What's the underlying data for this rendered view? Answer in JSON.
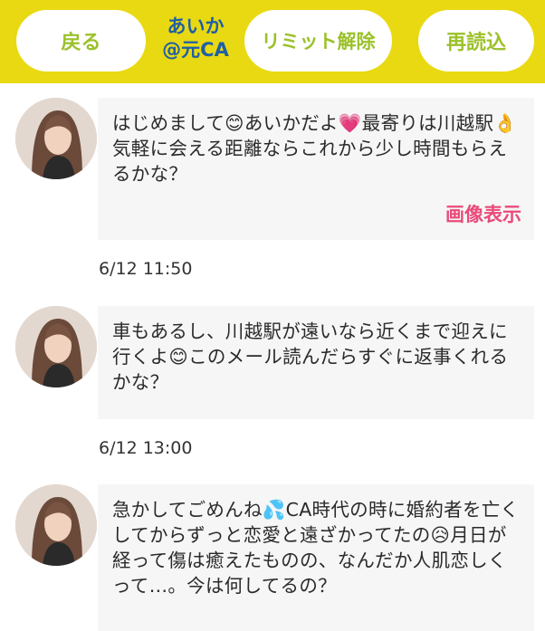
{
  "header": {
    "back_label": "戻る",
    "title_line1": "あいか",
    "title_line2": "@元CA",
    "limit_label": "リミット解除",
    "reload_label": "再読込",
    "bg_color": "#e9d912",
    "button_text_color": "#9bc12a",
    "title_color": "#1f5fa5"
  },
  "messages": [
    {
      "avatar_icon": "woman-portrait-icon",
      "text": "はじめまして😊あいかだよ💗最寄りは川越駅👌気軽に会える距離ならこれから少し時間もらえるかな？",
      "image_link": "画像表示"
    },
    {
      "timestamp": "6/12 11:50",
      "avatar_icon": "woman-portrait-icon",
      "text": "車もあるし、川越駅が遠いなら近くまで迎えに行くよ😊このメール読んだらすぐに返事くれるかな？"
    },
    {
      "timestamp": "6/12 13:00",
      "avatar_icon": "woman-portrait-icon",
      "text": "急かしてごめんね💦CA時代の時に婚約者を亡くしてからずっと恋愛と遠ざかってたの😥月日が経って傷は癒えたものの、なんだか人肌恋しくって…。今は何してるの？"
    }
  ],
  "link_color": "#ea4a7a"
}
